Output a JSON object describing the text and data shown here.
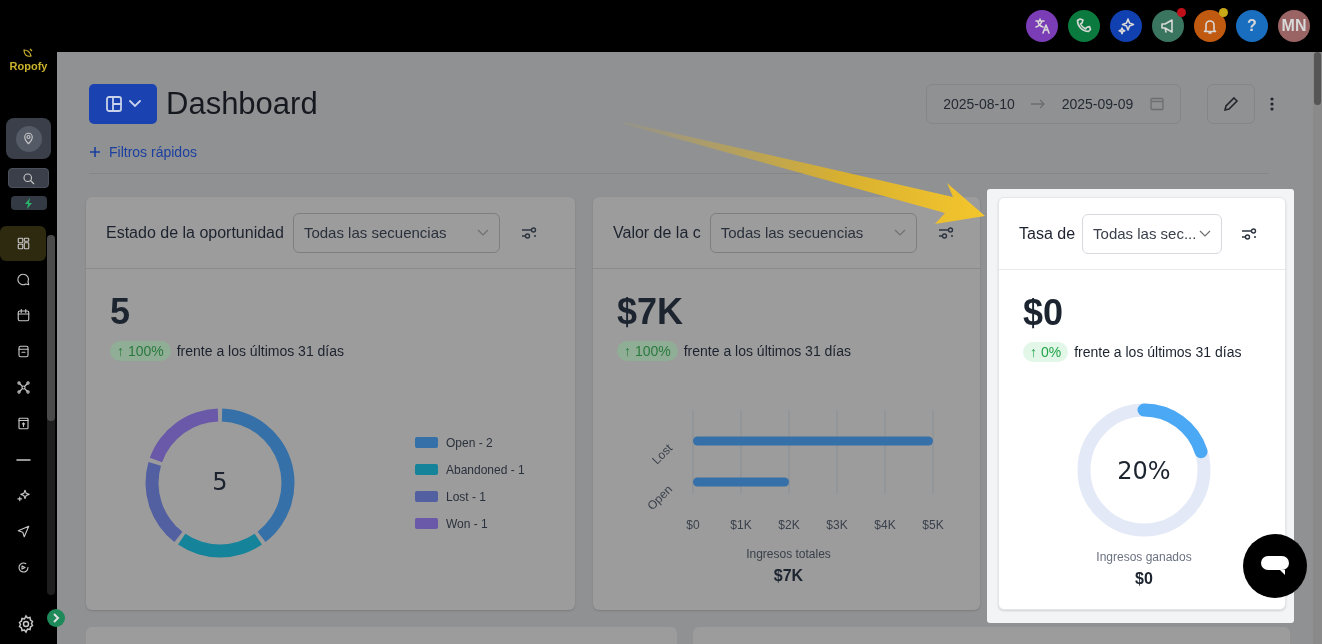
{
  "topbar": {
    "buttons": [
      {
        "color": "#7b3db5"
      },
      {
        "color": "#0b7a3e"
      },
      {
        "color": "#1140b0"
      },
      {
        "color": "#3a7560",
        "notification": true
      },
      {
        "color": "#c05a10",
        "notification": true
      },
      {
        "color": "#1a6ec0",
        "label": "?"
      },
      {
        "color": "#9a6464",
        "label": "MN"
      }
    ]
  },
  "sidebar": {
    "logo": "Ropofy",
    "nav": [
      {
        "selected": true
      },
      {
        "selected": false
      },
      {
        "selected": false
      },
      {
        "selected": false
      },
      {
        "selected": false
      },
      {
        "selected": false
      },
      {
        "selected": false
      },
      {
        "selected": false
      },
      {
        "selected": false
      },
      {
        "selected": false
      }
    ]
  },
  "header": {
    "title": "Dashboard",
    "date_from": "2025-08-10",
    "date_to": "2025-09-09",
    "quick_filters": "Filtros rápidos"
  },
  "cards": [
    {
      "kind": "donut",
      "highlighted": false,
      "title": "Estado de la oportunidad",
      "dropdown": "Todas las secuencias",
      "value": "5",
      "change": "↑ 100%",
      "comparison": "frente a los últimos 31 días",
      "center_label": "5",
      "chart_data": {
        "type": "donut",
        "categories": [
          "Open - 2",
          "Abandoned - 1",
          "Lost - 1",
          "Won - 1"
        ],
        "values": [
          40,
          20,
          20,
          20
        ],
        "colors": [
          "#3570a8",
          "#15849a",
          "#525fa0",
          "#6a58a8"
        ]
      }
    },
    {
      "kind": "bar",
      "highlighted": false,
      "title": "Valor de la c",
      "dropdown": "Todas las secuencias",
      "value": "$7K",
      "change": "↑ 100%",
      "comparison": "frente a los últimos 31 días",
      "chart_data": {
        "type": "bar",
        "orientation": "horizontal",
        "categories": [
          "Lost",
          "Open"
        ],
        "values": [
          5000,
          2000
        ],
        "xlim": [
          0,
          5000
        ],
        "grid": true,
        "xticks": [
          {
            "value": 0,
            "label": "$0"
          },
          {
            "value": 1000,
            "label": "$1K"
          },
          {
            "value": 2000,
            "label": "$2K"
          },
          {
            "value": 3000,
            "label": "$3K"
          },
          {
            "value": 4000,
            "label": "$4K"
          },
          {
            "value": 5000,
            "label": "$5K"
          }
        ]
      },
      "footer_label": "Ingresos totales",
      "footer_value": "$7K"
    },
    {
      "kind": "ring",
      "highlighted": true,
      "title": "Tasa de",
      "dropdown": "Todas las sec...",
      "value": "$0",
      "change": "↑ 0%",
      "comparison": "frente a los últimos 31 días",
      "level": 0.2,
      "reading": "20%",
      "footer_label": "Ingresos ganados",
      "footer_value": "$0"
    }
  ]
}
